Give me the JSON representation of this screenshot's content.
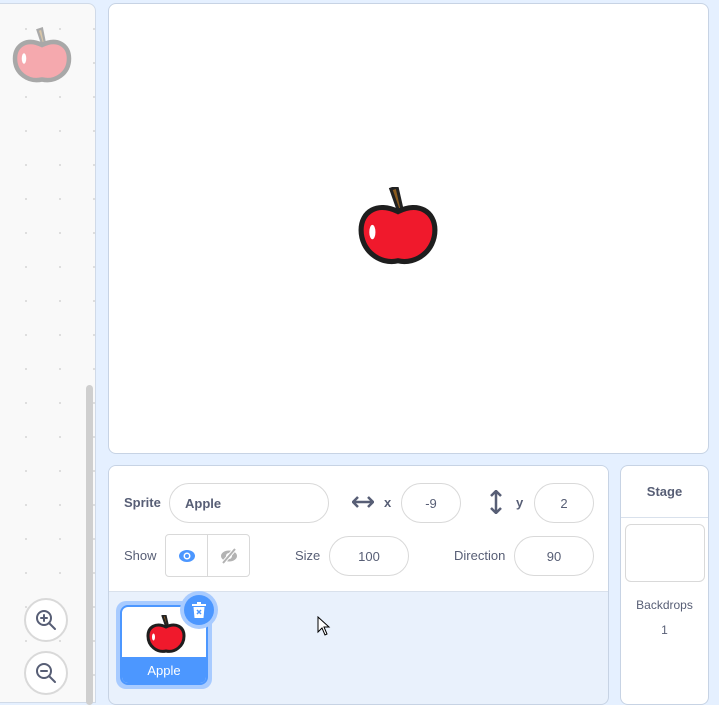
{
  "sprite_info": {
    "sprite_label": "Sprite",
    "sprite_name": "Apple",
    "x_label": "x",
    "x_value": "-9",
    "y_label": "y",
    "y_value": "2",
    "show_label": "Show",
    "size_label": "Size",
    "size_value": "100",
    "direction_label": "Direction",
    "direction_value": "90"
  },
  "sprites": [
    {
      "name": "Apple",
      "selected": true
    }
  ],
  "stage_panel": {
    "title": "Stage",
    "backdrops_label": "Backdrops",
    "backdrops_count": "1"
  },
  "colors": {
    "accent": "#4c97ff",
    "apple": "#f0192c"
  }
}
